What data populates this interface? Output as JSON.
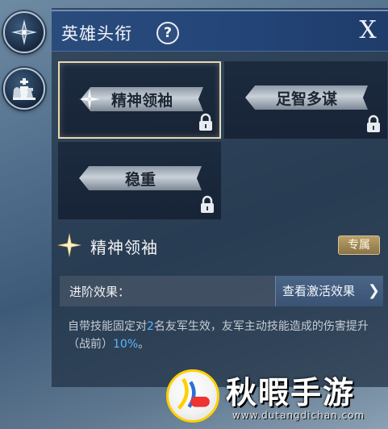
{
  "header": {
    "title": "英雄头衔",
    "help_label": "?",
    "close_label": "X"
  },
  "rail": {
    "items": [
      {
        "icon": "compass-emblem-icon"
      },
      {
        "icon": "chess-pieces-icon"
      }
    ]
  },
  "titles": [
    {
      "label": "精神领袖",
      "selected": true,
      "locked": true
    },
    {
      "label": "足智多谋",
      "selected": false,
      "locked": true
    },
    {
      "label": "稳重",
      "selected": false,
      "locked": true
    }
  ],
  "detail": {
    "name": "精神领袖",
    "badge": "专属",
    "effect_label": "进阶效果：",
    "view_button": "查看激活效果",
    "description": {
      "p1": "自带技能固定对",
      "n1": "2",
      "p2": "名友军生效，友军主动技能造成的伤害提升（战前）",
      "n2": "10%",
      "p3": "。"
    }
  },
  "watermark": {
    "title": "秋暇手游",
    "url": "www.dutangdichan.com"
  },
  "colors": {
    "header": "#234477",
    "highlight": "#58b7ff",
    "selected_border": "#e7d9b2",
    "badge": "#b9a06a"
  }
}
